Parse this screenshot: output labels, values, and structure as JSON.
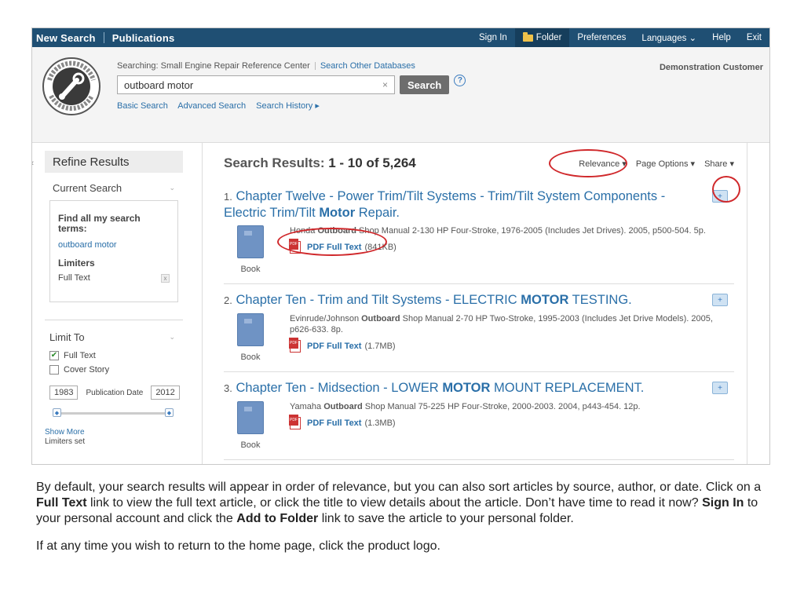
{
  "topbar": {
    "new_search": "New Search",
    "publications": "Publications",
    "sign_in": "Sign In",
    "folder": "Folder",
    "preferences": "Preferences",
    "languages": "Languages ⌄",
    "help": "Help",
    "exit": "Exit"
  },
  "header": {
    "searching_label": "Searching: Small Engine Repair Reference Center",
    "other_db": "Search Other Databases",
    "query": "outboard motor",
    "clear_glyph": "×",
    "search_button": "Search",
    "help_glyph": "?",
    "basic_search": "Basic Search",
    "advanced_search": "Advanced Search",
    "search_history": "Search History ▸",
    "customer": "Demonstration Customer"
  },
  "sidebar": {
    "collapse_glyph": "«",
    "refine_title": "Refine Results",
    "current_search": "Current Search",
    "find_all": "Find all my search terms:",
    "query_link": "outboard motor",
    "limiters": "Limiters",
    "full_text_limiter": "Full Text",
    "remove_glyph": "x",
    "limit_to": "Limit To",
    "cb_full_text": "Full Text",
    "cb_cover_story": "Cover Story",
    "date_from": "1983",
    "date_label": "Publication Date",
    "date_to": "2012",
    "show_more": "Show More",
    "limiters_set": "Limiters set"
  },
  "results_header": {
    "title_prefix": "Search Results: ",
    "range": "1 - 10 of 5,264",
    "relevance": "Relevance ▾",
    "page_options": "Page Options ▾",
    "share": "Share ▾"
  },
  "results": [
    {
      "num": "1.",
      "title_a": "Chapter Twelve - Power Trim/Tilt Systems - Trim/Tilt System Components - Electric Trim/Tilt ",
      "title_bold": "Motor",
      "title_b": " Repair.",
      "meta_a": "Honda ",
      "meta_bold": "Outboard",
      "meta_b": " Shop Manual 2-130 HP Four-Stroke, 1976-2005 (Includes Jet Drives). 2005, p500-504. 5p.",
      "pdf": "PDF Full Text",
      "size": "(841KB)",
      "type": "Book"
    },
    {
      "num": "2.",
      "title_a": "Chapter Ten - Trim and Tilt Systems - ELECTRIC ",
      "title_bold": "MOTOR",
      "title_b": " TESTING.",
      "meta_a": "Evinrude/Johnson ",
      "meta_bold": "Outboard",
      "meta_b": " Shop Manual 2-70 HP Two-Stroke, 1995-2003 (Includes Jet Drive Models). 2005, p626-633. 8p.",
      "pdf": "PDF Full Text",
      "size": "(1.7MB)",
      "type": "Book"
    },
    {
      "num": "3.",
      "title_a": "Chapter Ten - Midsection - LOWER ",
      "title_bold": "MOTOR",
      "title_b": " MOUNT REPLACEMENT.",
      "meta_a": "Yamaha ",
      "meta_bold": "Outboard",
      "meta_b": " Shop Manual 75-225 HP Four-Stroke, 2000-2003. 2004, p443-454. 12p.",
      "pdf": "PDF Full Text",
      "size": "(1.3MB)",
      "type": "Book"
    }
  ],
  "caption": {
    "p1_a": "By default, your search results will appear in order of relevance, but you can also sort articles by source, author, or date. Click on a ",
    "p1_b": "Full Text",
    "p1_c": " link to view the full text article, or click the title to view details about the article. Don’t have time to read it now? ",
    "p1_d": "Sign In",
    "p1_e": " to your personal account and click the ",
    "p1_f": "Add to Folder",
    "p1_g": " link to save the article to your personal folder.",
    "p2": "If at any time you wish to return to the home page, click the product logo."
  },
  "colors": {
    "topbar": "#1f4f73",
    "link": "#2a6fa8",
    "annotation": "#d0282b"
  }
}
